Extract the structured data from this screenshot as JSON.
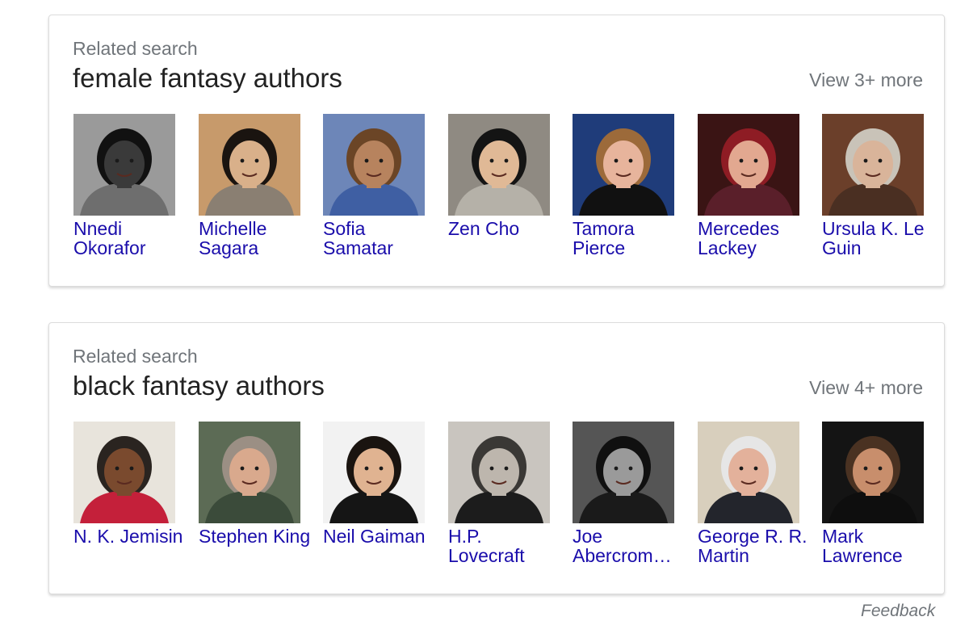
{
  "cards": [
    {
      "kicker": "Related search",
      "title": "female fantasy authors",
      "view_more": "View 3+ more",
      "people": [
        {
          "name": "Nnedi Okorafor",
          "photo_icon": "person-photo",
          "bg": "#9a9a9a",
          "skin": "#3a3a3a",
          "hair": "#111111",
          "shirt": "#6e6e6e"
        },
        {
          "name": "Michelle Sagara",
          "photo_icon": "person-photo",
          "bg": "#c79a6b",
          "skin": "#d9b08a",
          "hair": "#1a1410",
          "shirt": "#8a7f72"
        },
        {
          "name": "Sofia Samatar",
          "photo_icon": "person-photo",
          "bg": "#6d86b8",
          "skin": "#b7835e",
          "hair": "#6b4526",
          "shirt": "#3f5fa3"
        },
        {
          "name": "Zen Cho",
          "photo_icon": "person-photo",
          "bg": "#8f8a82",
          "skin": "#e0b996",
          "hair": "#141414",
          "shirt": "#b5b1a8"
        },
        {
          "name": "Tamora Pierce",
          "photo_icon": "person-photo",
          "bg": "#1f3c7a",
          "skin": "#e7b49c",
          "hair": "#9c6a3a",
          "shirt": "#111111"
        },
        {
          "name": "Mercedes Lackey",
          "photo_icon": "person-photo",
          "bg": "#3a1414",
          "skin": "#e2a890",
          "hair": "#8e1c24",
          "shirt": "#5a1f2a"
        },
        {
          "name": "Ursula K. Le Guin",
          "photo_icon": "person-photo",
          "bg": "#6b3f2a",
          "skin": "#d9b49a",
          "hair": "#c9c3b8",
          "shirt": "#4a2f22"
        }
      ]
    },
    {
      "kicker": "Related search",
      "title": "black fantasy authors",
      "view_more": "View 4+ more",
      "people": [
        {
          "name": "N. K. Jemisin",
          "photo_icon": "person-photo",
          "bg": "#e8e4dc",
          "skin": "#7a4a2e",
          "hair": "#2a2420",
          "shirt": "#c4203a"
        },
        {
          "name": "Stephen King",
          "photo_icon": "person-photo",
          "bg": "#5c6b55",
          "skin": "#d9a98d",
          "hair": "#9b8f84",
          "shirt": "#3b4b3a"
        },
        {
          "name": "Neil Gaiman",
          "photo_icon": "person-photo",
          "bg": "#f2f2f2",
          "skin": "#e0b391",
          "hair": "#1a1410",
          "shirt": "#151515"
        },
        {
          "name": "H.P. Lovecraft",
          "photo_icon": "person-photo",
          "bg": "#c9c5bf",
          "skin": "#bdb6ad",
          "hair": "#3a3835",
          "shirt": "#1c1c1c"
        },
        {
          "name": "Joe Abercrom…",
          "photo_icon": "person-photo",
          "bg": "#555555",
          "skin": "#9a9a9a",
          "hair": "#101010",
          "shirt": "#1a1a1a"
        },
        {
          "name": "George R. R. Martin",
          "photo_icon": "person-photo",
          "bg": "#d8cfbd",
          "skin": "#e3b19b",
          "hair": "#e6e6e6",
          "shirt": "#23252c"
        },
        {
          "name": "Mark Lawrence",
          "photo_icon": "person-photo",
          "bg": "#141414",
          "skin": "#c88e6c",
          "hair": "#4a3222",
          "shirt": "#0e0e0e"
        }
      ]
    }
  ],
  "footer": {
    "feedback": "Feedback"
  },
  "colors": {
    "link": "#1a0dab",
    "muted": "#70757a",
    "title": "#222222"
  }
}
